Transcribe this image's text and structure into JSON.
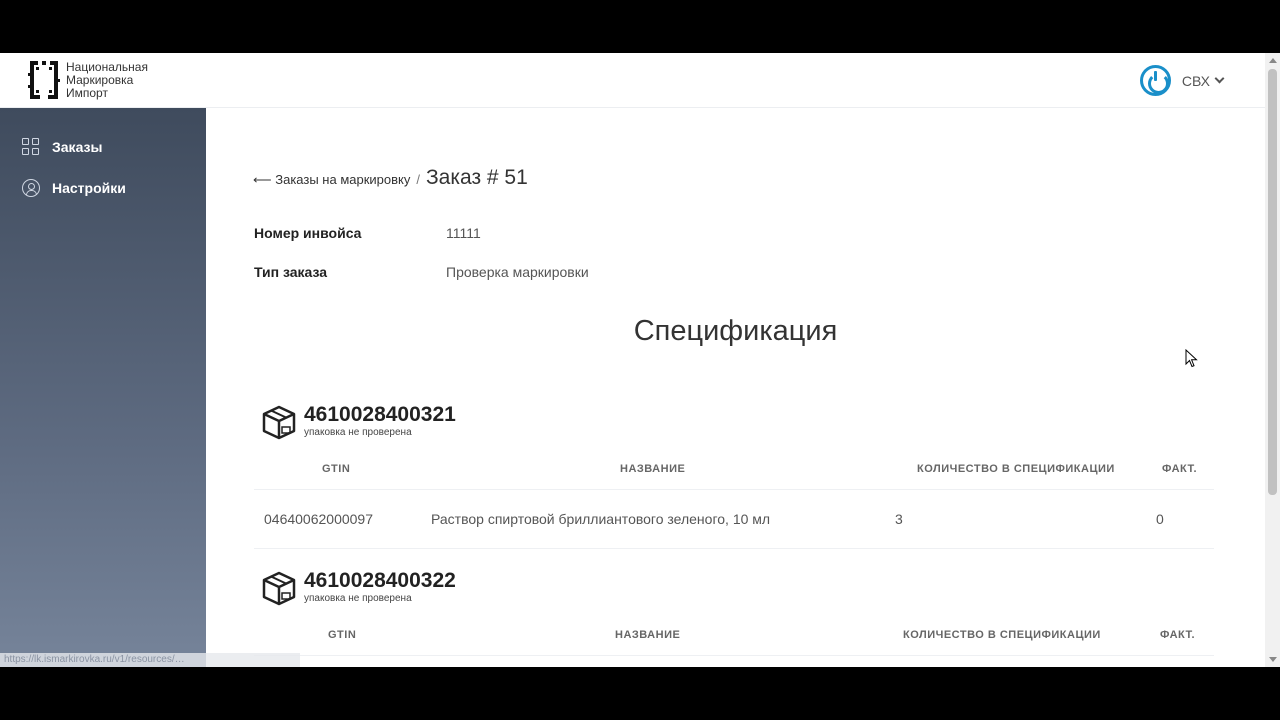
{
  "header": {
    "logo_lines": [
      "Национальная",
      "Маркировка",
      "Импорт"
    ],
    "user_name": "СВХ"
  },
  "sidebar": {
    "items": [
      {
        "label": "Заказы",
        "icon": "grid-icon",
        "active": true
      },
      {
        "label": "Настройки",
        "icon": "user-circle-icon",
        "active": false
      }
    ]
  },
  "breadcrumb": {
    "back_label": "⟵ Заказы на маркировку",
    "separator": "/",
    "current": "Заказ # 51"
  },
  "order": {
    "invoice_label": "Номер инвойса",
    "invoice_value": "11111",
    "type_label": "Тип заказа",
    "type_value": "Проверка маркировки"
  },
  "spec": {
    "title": "Спецификация",
    "columns": [
      "GTIN",
      "НАЗВАНИЕ",
      "КОЛИЧЕСТВО В СПЕЦИФИКАЦИИ",
      "ФАКТ."
    ],
    "boxes": [
      {
        "code": "4610028400321",
        "status": "упаковка не проверена",
        "rows": [
          {
            "gtin": "04640062000097",
            "name": "Раствор спиртовой бриллиантового зеленого, 10 мл",
            "qty": "3",
            "fact": "0"
          }
        ]
      },
      {
        "code": "4610028400322",
        "status": "упаковка не проверена",
        "rows": []
      }
    ]
  },
  "statusbar": {
    "url": "https://lk.ismarkirovka.ru/v1/resources/…"
  },
  "colors": {
    "accent": "#1a8fc9",
    "sidebar_top": "#3f4b5d",
    "sidebar_bottom": "#76849a"
  }
}
